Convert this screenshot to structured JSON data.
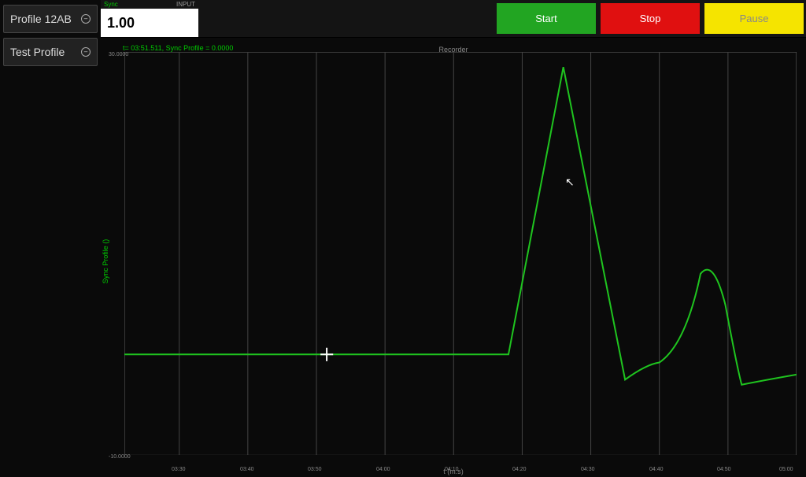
{
  "sidebar": {
    "profiles": [
      {
        "label": "Profile 12AB"
      },
      {
        "label": "Test Profile"
      }
    ]
  },
  "topbar": {
    "input": {
      "left_label": "Sync",
      "right_label": "INPUT",
      "value": "1.00"
    },
    "buttons": {
      "start": "Start",
      "stop": "Stop",
      "pause": "Pause"
    }
  },
  "chart": {
    "title": "Recorder",
    "overlay_label": "t= 03:51.511, Sync Profile = 0.0000",
    "y_axis_caption": "Sync Profile ()",
    "x_axis_caption": "t (m:s)",
    "x_ticks": [
      "03:30",
      "03:40",
      "03:50",
      "04:00",
      "04:10",
      "04:20",
      "04:30",
      "04:40",
      "04:50",
      "05:00"
    ],
    "y_ticks_top": "30.0000",
    "y_ticks_bottom": "-10.0000"
  },
  "chart_data": {
    "type": "line",
    "title": "Recorder",
    "xlabel": "t (m:s)",
    "ylabel": "Sync Profile ()",
    "x_range_seconds": [
      202,
      300
    ],
    "ylim": [
      -10,
      30
    ],
    "series": [
      {
        "name": "Sync Profile",
        "points": [
          {
            "t": 202,
            "y": 0.0
          },
          {
            "t": 258,
            "y": 0.0
          },
          {
            "t": 266,
            "y": 28.5
          },
          {
            "t": 275,
            "y": -2.5
          },
          {
            "t": 280,
            "y": -0.8
          },
          {
            "t": 286,
            "y": 8.0
          },
          {
            "t": 292,
            "y": -3.0
          },
          {
            "t": 300,
            "y": -2.0
          }
        ]
      }
    ],
    "cursor": {
      "t": 231.5,
      "y": 0.0
    },
    "mouse_pointer_approx": {
      "t": 264,
      "y": 17
    }
  }
}
